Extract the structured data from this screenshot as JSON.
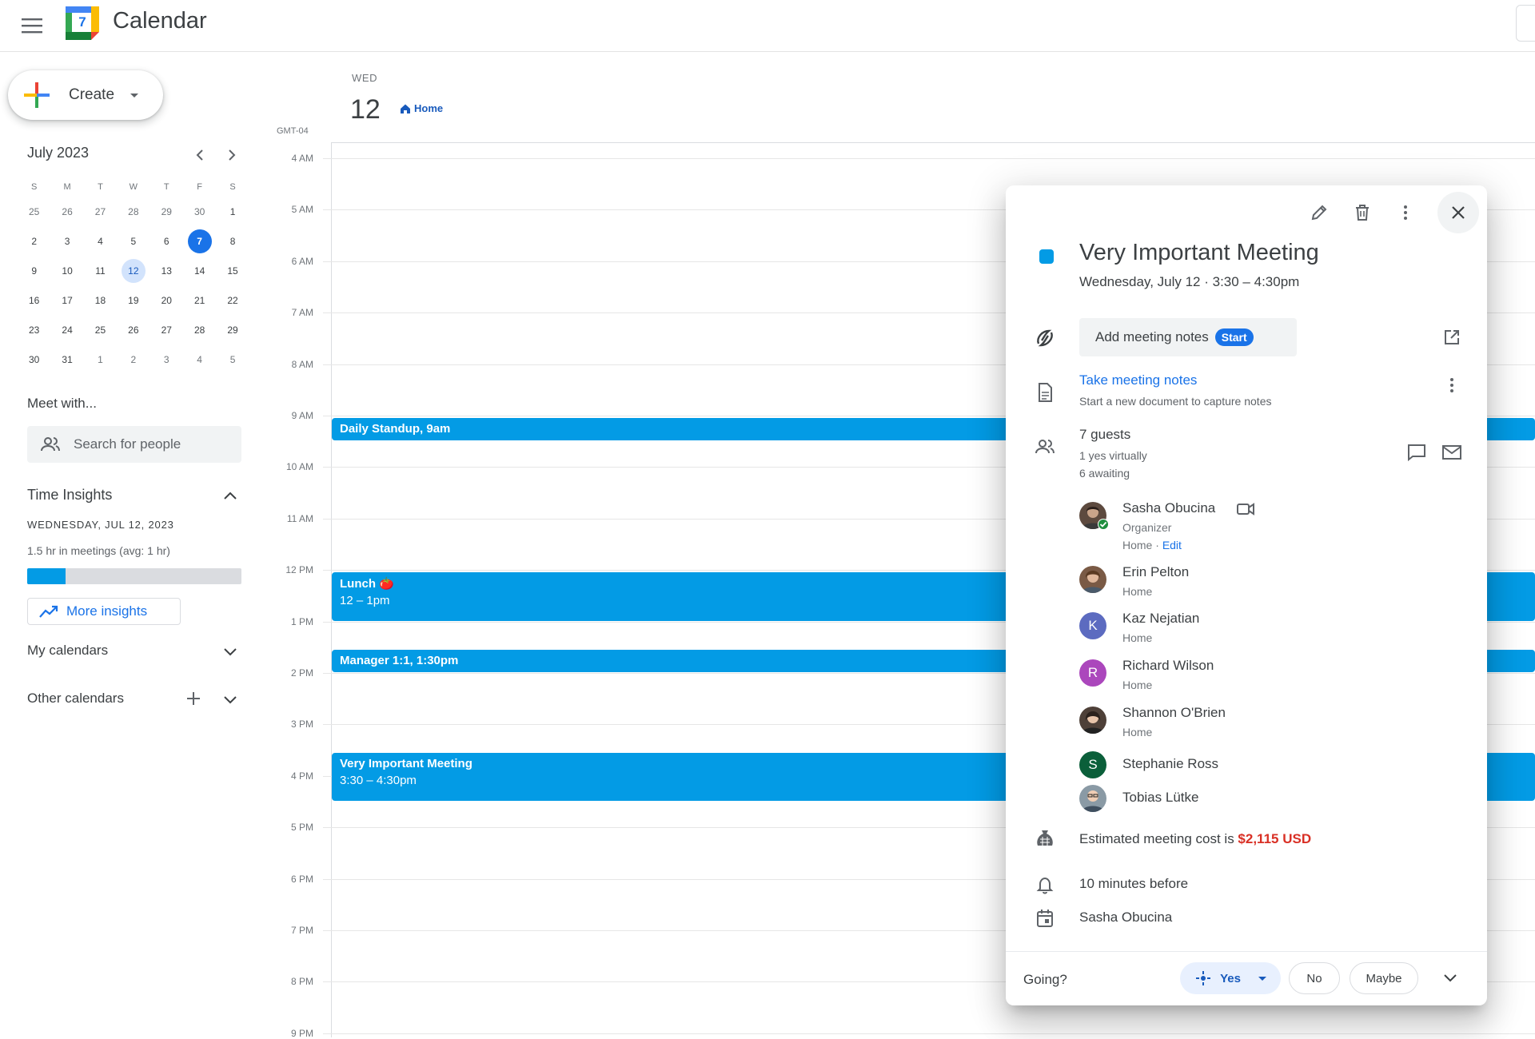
{
  "header": {
    "app_title": "Calendar",
    "logo_day": "7"
  },
  "sidebar": {
    "create_label": "Create",
    "mini_calendar": {
      "month_label": "July 2023",
      "weekdays": [
        "S",
        "M",
        "T",
        "W",
        "T",
        "F",
        "S"
      ],
      "weeks": [
        [
          "25",
          "26",
          "27",
          "28",
          "29",
          "30",
          "1"
        ],
        [
          "2",
          "3",
          "4",
          "5",
          "6",
          "7",
          "8"
        ],
        [
          "9",
          "10",
          "11",
          "12",
          "13",
          "14",
          "15"
        ],
        [
          "16",
          "17",
          "18",
          "19",
          "20",
          "21",
          "22"
        ],
        [
          "23",
          "24",
          "25",
          "26",
          "27",
          "28",
          "29"
        ],
        [
          "30",
          "31",
          "1",
          "2",
          "3",
          "4",
          "5"
        ]
      ],
      "today": "7",
      "selected": "12"
    },
    "meet_with": {
      "title": "Meet with...",
      "search_placeholder": "Search for people"
    },
    "time_insights": {
      "title": "Time Insights",
      "date": "WEDNESDAY, JUL 12, 2023",
      "summary": "1.5 hr in meetings (avg: 1 hr)",
      "progress": 0.18,
      "more_label": "More insights"
    },
    "my_calendars": "My calendars",
    "other_calendars": "Other calendars"
  },
  "day": {
    "weekday": "WED",
    "date": "12",
    "location": "Home",
    "timezone": "GMT-04",
    "hours": [
      "4 AM",
      "5 AM",
      "6 AM",
      "7 AM",
      "8 AM",
      "9 AM",
      "10 AM",
      "11 AM",
      "12 PM",
      "1 PM",
      "2 PM",
      "3 PM",
      "4 PM",
      "5 PM",
      "6 PM",
      "7 PM",
      "8 PM",
      "9 PM"
    ]
  },
  "events": [
    {
      "title": "Daily Standup, 9am",
      "subtitle": "",
      "start": 9.0,
      "end": 9.5
    },
    {
      "title": "Lunch 🍅",
      "subtitle": "12 – 1pm",
      "start": 12.0,
      "end": 13.0
    },
    {
      "title": "Manager 1:1, 1:30pm",
      "subtitle": "",
      "start": 13.5,
      "end": 14.0
    },
    {
      "title": "Very Important Meeting",
      "subtitle": "3:30 – 4:30pm",
      "start": 15.5,
      "end": 16.5
    }
  ],
  "popover": {
    "color": "#039be5",
    "title": "Very Important Meeting",
    "when": "Wednesday, July 12  ·  3:30 – 4:30pm",
    "notes_button": "Add meeting notes",
    "notes_badge": "Start",
    "take_notes": "Take meeting notes",
    "take_notes_sub": "Start a new document to capture notes",
    "guests_count": "7 guests",
    "guests_yes": "1 yes virtually",
    "guests_awaiting": "6 awaiting",
    "guests": [
      {
        "name": "Sasha Obucina",
        "role": "Organizer",
        "location": "Home",
        "edit": "Edit",
        "avatar": "",
        "color": "#5d4a3f"
      },
      {
        "name": "Erin Pelton",
        "location": "Home",
        "avatar": "",
        "color": "#7a5a45"
      },
      {
        "name": "Kaz Nejatian",
        "location": "Home",
        "avatar": "K",
        "color": "#5c6bc0"
      },
      {
        "name": "Richard Wilson",
        "location": "Home",
        "avatar": "R",
        "color": "#ab47bc"
      },
      {
        "name": "Shannon O'Brien",
        "location": "Home",
        "avatar": "",
        "color": "#4e4038"
      },
      {
        "name": "Stephanie Ross",
        "location": "",
        "avatar": "S",
        "color": "#0b5f3a"
      },
      {
        "name": "Tobias Lütke",
        "location": "",
        "avatar": "",
        "color": "#8a9aa5"
      }
    ],
    "cost_prefix": "Estimated meeting cost is ",
    "cost_amount": "$2,115 USD",
    "reminder": "10 minutes before",
    "owner": "Sasha Obucina",
    "going_label": "Going?",
    "rsvp_yes": "Yes",
    "rsvp_no": "No",
    "rsvp_maybe": "Maybe"
  }
}
